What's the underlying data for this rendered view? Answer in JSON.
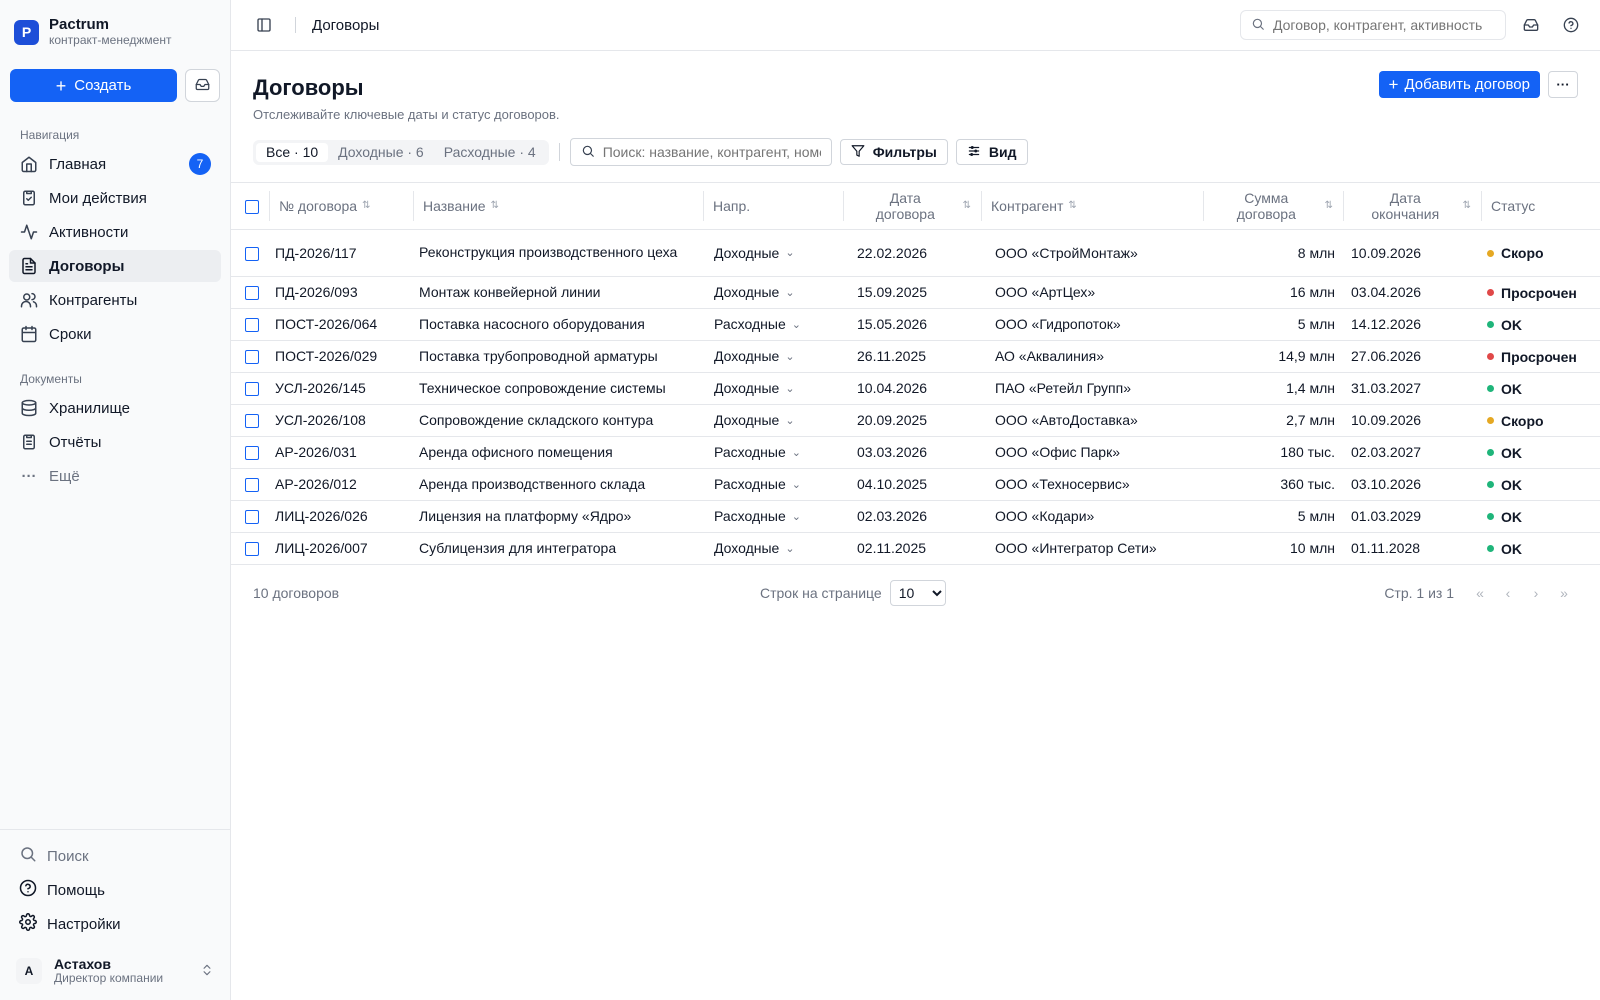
{
  "brand": {
    "logo_letter": "P",
    "name": "Pactrum",
    "subtitle": "контракт-менеджмент"
  },
  "sidebar": {
    "create_label": "Создать",
    "nav_section_label": "Навигация",
    "nav_items": [
      {
        "label": "Главная",
        "icon": "home-icon",
        "badge": "7"
      },
      {
        "label": "Мои действия",
        "icon": "clipboard-check-icon"
      },
      {
        "label": "Активности",
        "icon": "activity-icon"
      },
      {
        "label": "Договоры",
        "icon": "file-text-icon",
        "active": true
      },
      {
        "label": "Контрагенты",
        "icon": "users-icon"
      },
      {
        "label": "Сроки",
        "icon": "calendar-icon"
      }
    ],
    "docs_section_label": "Документы",
    "doc_items": [
      {
        "label": "Хранилище",
        "icon": "database-icon"
      },
      {
        "label": "Отчёты",
        "icon": "clipboard-list-icon"
      },
      {
        "label": "Ещё",
        "icon": "more-horizontal-icon"
      }
    ],
    "bottom_items": [
      {
        "label": "Поиск",
        "icon": "search-icon"
      },
      {
        "label": "Помощь",
        "icon": "help-circle-icon"
      },
      {
        "label": "Настройки",
        "icon": "settings-icon"
      }
    ],
    "user": {
      "initial": "A",
      "name": "Астахов",
      "role": "Директор компании"
    }
  },
  "topbar": {
    "breadcrumb": "Договоры",
    "search_placeholder": "Договор, контрагент, активность"
  },
  "page": {
    "title": "Договоры",
    "subtitle": "Отслеживайте ключевые даты и статус договоров.",
    "add_button": "Добавить договор"
  },
  "toolbar": {
    "segments": [
      "Все · 10",
      "Доходные · 6",
      "Расходные · 4"
    ],
    "search_placeholder": "Поиск: название, контрагент, номер",
    "filters_label": "Фильтры",
    "view_label": "Вид"
  },
  "table": {
    "columns": {
      "number": "№ договора",
      "name": "Название",
      "direction": "Напр.",
      "date_line1": "Дата",
      "date_line2": "договора",
      "counterparty": "Контрагент",
      "amount_line1": "Сумма",
      "amount_line2": "договора",
      "end_line1": "Дата",
      "end_line2": "окончания",
      "status": "Статус"
    },
    "rows": [
      {
        "number": "ПД-2026/117",
        "name": "Реконструкция производственного цеха",
        "direction": "Доходные",
        "date": "22.02.2026",
        "counterparty": "ООО «СтройМонтаж»",
        "amount": "8 млн",
        "end": "10.09.2026",
        "status": "Скоро",
        "status_color": "#e5a823"
      },
      {
        "number": "ПД-2026/093",
        "name": "Монтаж конвейерной линии",
        "direction": "Доходные",
        "date": "15.09.2025",
        "counterparty": "ООО «АртЦех»",
        "amount": "16 млн",
        "end": "03.04.2026",
        "status": "Просрочен",
        "status_color": "#e04848"
      },
      {
        "number": "ПОСТ-2026/064",
        "name": "Поставка насосного оборудования",
        "direction": "Расходные",
        "date": "15.05.2026",
        "counterparty": "ООО «Гидропоток»",
        "amount": "5 млн",
        "end": "14.12.2026",
        "status": "OK",
        "status_color": "#1fb57a"
      },
      {
        "number": "ПОСТ-2026/029",
        "name": "Поставка трубопроводной арматуры",
        "direction": "Доходные",
        "date": "26.11.2025",
        "counterparty": "АО «Аквалиния»",
        "amount": "14,9 млн",
        "end": "27.06.2026",
        "status": "Просрочен",
        "status_color": "#e04848"
      },
      {
        "number": "УСЛ-2026/145",
        "name": "Техническое сопровождение системы",
        "direction": "Доходные",
        "date": "10.04.2026",
        "counterparty": "ПАО «Ретейл Групп»",
        "amount": "1,4 млн",
        "end": "31.03.2027",
        "status": "OK",
        "status_color": "#1fb57a"
      },
      {
        "number": "УСЛ-2026/108",
        "name": "Сопровождение складского контура",
        "direction": "Доходные",
        "date": "20.09.2025",
        "counterparty": "ООО «АвтоДоставка»",
        "amount": "2,7 млн",
        "end": "10.09.2026",
        "status": "Скоро",
        "status_color": "#e5a823"
      },
      {
        "number": "АР-2026/031",
        "name": "Аренда офисного помещения",
        "direction": "Расходные",
        "date": "03.03.2026",
        "counterparty": "ООО «Офис Парк»",
        "amount": "180 тыс.",
        "end": "02.03.2027",
        "status": "OK",
        "status_color": "#1fb57a"
      },
      {
        "number": "АР-2026/012",
        "name": "Аренда производственного склада",
        "direction": "Расходные",
        "date": "04.10.2025",
        "counterparty": "ООО «Техносервис»",
        "amount": "360 тыс.",
        "end": "03.10.2026",
        "status": "OK",
        "status_color": "#1fb57a"
      },
      {
        "number": "ЛИЦ-2026/026",
        "name": "Лицензия на платформу «Ядро»",
        "direction": "Расходные",
        "date": "02.03.2026",
        "counterparty": "ООО «Кодари»",
        "amount": "5 млн",
        "end": "01.03.2029",
        "status": "OK",
        "status_color": "#1fb57a"
      },
      {
        "number": "ЛИЦ-2026/007",
        "name": "Сублицензия для интегратора",
        "direction": "Доходные",
        "date": "02.11.2025",
        "counterparty": "ООО «Интегратор Сети»",
        "amount": "10 млн",
        "end": "01.11.2028",
        "status": "OK",
        "status_color": "#1fb57a"
      }
    ]
  },
  "footer": {
    "count": "10 договоров",
    "rows_per_page_label": "Строк на странице",
    "rows_per_page_value": "10",
    "page_label": "Стр. 1 из 1"
  }
}
